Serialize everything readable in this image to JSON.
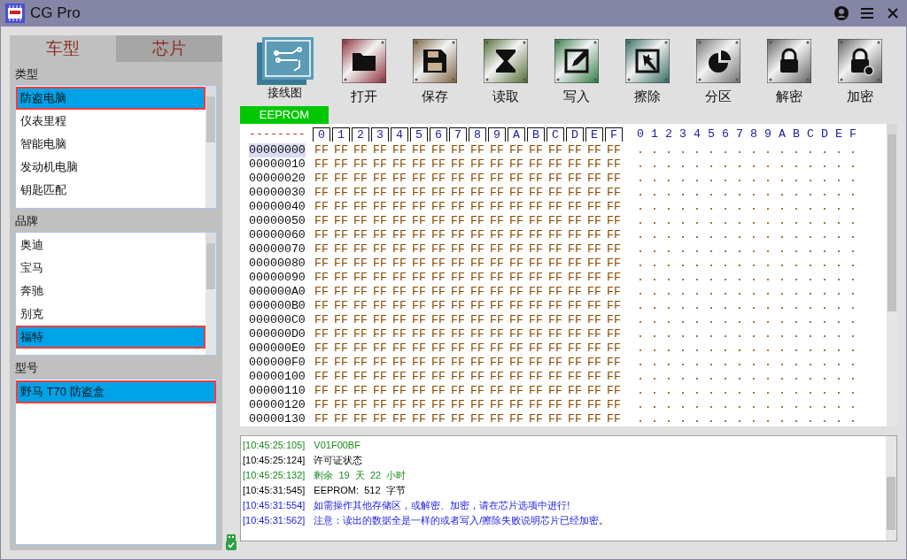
{
  "window": {
    "title": "CG Pro"
  },
  "tabs": [
    {
      "label": "车型",
      "selected": true
    },
    {
      "label": "芯片",
      "selected": false
    }
  ],
  "sections": [
    {
      "label": "类型",
      "items": [
        {
          "label": "防盗电脑",
          "selected": true
        },
        {
          "label": "仪表里程",
          "selected": false
        },
        {
          "label": "智能电脑",
          "selected": false
        },
        {
          "label": "发动机电脑",
          "selected": false
        },
        {
          "label": "钥匙匹配",
          "selected": false
        }
      ]
    },
    {
      "label": "品牌",
      "items": [
        {
          "label": "奥迪",
          "selected": false
        },
        {
          "label": "宝马",
          "selected": false
        },
        {
          "label": "奔驰",
          "selected": false
        },
        {
          "label": "别克",
          "selected": false
        },
        {
          "label": "福特",
          "selected": true
        }
      ]
    },
    {
      "label": "型号",
      "items": [
        {
          "label": "野马 T70 防盗盒",
          "selected": true
        }
      ]
    }
  ],
  "toolbar": [
    {
      "kind": "diagram",
      "label": "接线图"
    },
    {
      "kind": "open",
      "label": "打开"
    },
    {
      "kind": "save",
      "label": "保存"
    },
    {
      "kind": "read",
      "label": "读取"
    },
    {
      "kind": "write",
      "label": "写入"
    },
    {
      "kind": "erase",
      "label": "擦除"
    },
    {
      "kind": "partition",
      "label": "分区"
    },
    {
      "kind": "unlock",
      "label": "解密"
    },
    {
      "kind": "lock",
      "label": "加密"
    }
  ],
  "memory_tab": "EEPROM",
  "hex": {
    "corner": "--------",
    "columns": [
      "0",
      "1",
      "2",
      "3",
      "4",
      "5",
      "6",
      "7",
      "8",
      "9",
      "A",
      "B",
      "C",
      "D",
      "E",
      "F"
    ],
    "ascii_columns": [
      "0",
      "1",
      "2",
      "3",
      "4",
      "5",
      "6",
      "7",
      "8",
      "9",
      "A",
      "B",
      "C",
      "D",
      "E",
      "F"
    ],
    "rows": [
      {
        "address": "00000000",
        "selected": true,
        "bytes": [
          "FF",
          "FF",
          "FF",
          "FF",
          "FF",
          "FF",
          "FF",
          "FF",
          "FF",
          "FF",
          "FF",
          "FF",
          "FF",
          "FF",
          "FF",
          "FF"
        ],
        "ascii": [
          ".",
          ".",
          ".",
          ".",
          ".",
          ".",
          ".",
          ".",
          ".",
          ".",
          ".",
          ".",
          ".",
          ".",
          ".",
          "."
        ]
      },
      {
        "address": "00000010",
        "selected": false,
        "bytes": [
          "FF",
          "FF",
          "FF",
          "FF",
          "FF",
          "FF",
          "FF",
          "FF",
          "FF",
          "FF",
          "FF",
          "FF",
          "FF",
          "FF",
          "FF",
          "FF"
        ],
        "ascii": [
          ".",
          ".",
          ".",
          ".",
          ".",
          ".",
          ".",
          ".",
          ".",
          ".",
          ".",
          ".",
          ".",
          ".",
          ".",
          "."
        ]
      },
      {
        "address": "00000020",
        "selected": false,
        "bytes": [
          "FF",
          "FF",
          "FF",
          "FF",
          "FF",
          "FF",
          "FF",
          "FF",
          "FF",
          "FF",
          "FF",
          "FF",
          "FF",
          "FF",
          "FF",
          "FF"
        ],
        "ascii": [
          ".",
          ".",
          ".",
          ".",
          ".",
          ".",
          ".",
          ".",
          ".",
          ".",
          ".",
          ".",
          ".",
          ".",
          ".",
          "."
        ]
      },
      {
        "address": "00000030",
        "selected": false,
        "bytes": [
          "FF",
          "FF",
          "FF",
          "FF",
          "FF",
          "FF",
          "FF",
          "FF",
          "FF",
          "FF",
          "FF",
          "FF",
          "FF",
          "FF",
          "FF",
          "FF"
        ],
        "ascii": [
          ".",
          ".",
          ".",
          ".",
          ".",
          ".",
          ".",
          ".",
          ".",
          ".",
          ".",
          ".",
          ".",
          ".",
          ".",
          "."
        ]
      },
      {
        "address": "00000040",
        "selected": false,
        "bytes": [
          "FF",
          "FF",
          "FF",
          "FF",
          "FF",
          "FF",
          "FF",
          "FF",
          "FF",
          "FF",
          "FF",
          "FF",
          "FF",
          "FF",
          "FF",
          "FF"
        ],
        "ascii": [
          ".",
          ".",
          ".",
          ".",
          ".",
          ".",
          ".",
          ".",
          ".",
          ".",
          ".",
          ".",
          ".",
          ".",
          ".",
          "."
        ]
      },
      {
        "address": "00000050",
        "selected": false,
        "bytes": [
          "FF",
          "FF",
          "FF",
          "FF",
          "FF",
          "FF",
          "FF",
          "FF",
          "FF",
          "FF",
          "FF",
          "FF",
          "FF",
          "FF",
          "FF",
          "FF"
        ],
        "ascii": [
          ".",
          ".",
          ".",
          ".",
          ".",
          ".",
          ".",
          ".",
          ".",
          ".",
          ".",
          ".",
          ".",
          ".",
          ".",
          "."
        ]
      },
      {
        "address": "00000060",
        "selected": false,
        "bytes": [
          "FF",
          "FF",
          "FF",
          "FF",
          "FF",
          "FF",
          "FF",
          "FF",
          "FF",
          "FF",
          "FF",
          "FF",
          "FF",
          "FF",
          "FF",
          "FF"
        ],
        "ascii": [
          ".",
          ".",
          ".",
          ".",
          ".",
          ".",
          ".",
          ".",
          ".",
          ".",
          ".",
          ".",
          ".",
          ".",
          ".",
          "."
        ]
      },
      {
        "address": "00000070",
        "selected": false,
        "bytes": [
          "FF",
          "FF",
          "FF",
          "FF",
          "FF",
          "FF",
          "FF",
          "FF",
          "FF",
          "FF",
          "FF",
          "FF",
          "FF",
          "FF",
          "FF",
          "FF"
        ],
        "ascii": [
          ".",
          ".",
          ".",
          ".",
          ".",
          ".",
          ".",
          ".",
          ".",
          ".",
          ".",
          ".",
          ".",
          ".",
          ".",
          "."
        ]
      },
      {
        "address": "00000080",
        "selected": false,
        "bytes": [
          "FF",
          "FF",
          "FF",
          "FF",
          "FF",
          "FF",
          "FF",
          "FF",
          "FF",
          "FF",
          "FF",
          "FF",
          "FF",
          "FF",
          "FF",
          "FF"
        ],
        "ascii": [
          ".",
          ".",
          ".",
          ".",
          ".",
          ".",
          ".",
          ".",
          ".",
          ".",
          ".",
          ".",
          ".",
          ".",
          ".",
          "."
        ]
      },
      {
        "address": "00000090",
        "selected": false,
        "bytes": [
          "FF",
          "FF",
          "FF",
          "FF",
          "FF",
          "FF",
          "FF",
          "FF",
          "FF",
          "FF",
          "FF",
          "FF",
          "FF",
          "FF",
          "FF",
          "FF"
        ],
        "ascii": [
          ".",
          ".",
          ".",
          ".",
          ".",
          ".",
          ".",
          ".",
          ".",
          ".",
          ".",
          ".",
          ".",
          ".",
          ".",
          "."
        ]
      },
      {
        "address": "000000A0",
        "selected": false,
        "bytes": [
          "FF",
          "FF",
          "FF",
          "FF",
          "FF",
          "FF",
          "FF",
          "FF",
          "FF",
          "FF",
          "FF",
          "FF",
          "FF",
          "FF",
          "FF",
          "FF"
        ],
        "ascii": [
          ".",
          ".",
          ".",
          ".",
          ".",
          ".",
          ".",
          ".",
          ".",
          ".",
          ".",
          ".",
          ".",
          ".",
          ".",
          "."
        ]
      },
      {
        "address": "000000B0",
        "selected": false,
        "bytes": [
          "FF",
          "FF",
          "FF",
          "FF",
          "FF",
          "FF",
          "FF",
          "FF",
          "FF",
          "FF",
          "FF",
          "FF",
          "FF",
          "FF",
          "FF",
          "FF"
        ],
        "ascii": [
          ".",
          ".",
          ".",
          ".",
          ".",
          ".",
          ".",
          ".",
          ".",
          ".",
          ".",
          ".",
          ".",
          ".",
          ".",
          "."
        ]
      },
      {
        "address": "000000C0",
        "selected": false,
        "bytes": [
          "FF",
          "FF",
          "FF",
          "FF",
          "FF",
          "FF",
          "FF",
          "FF",
          "FF",
          "FF",
          "FF",
          "FF",
          "FF",
          "FF",
          "FF",
          "FF"
        ],
        "ascii": [
          ".",
          ".",
          ".",
          ".",
          ".",
          ".",
          ".",
          ".",
          ".",
          ".",
          ".",
          ".",
          ".",
          ".",
          ".",
          "."
        ]
      },
      {
        "address": "000000D0",
        "selected": false,
        "bytes": [
          "FF",
          "FF",
          "FF",
          "FF",
          "FF",
          "FF",
          "FF",
          "FF",
          "FF",
          "FF",
          "FF",
          "FF",
          "FF",
          "FF",
          "FF",
          "FF"
        ],
        "ascii": [
          ".",
          ".",
          ".",
          ".",
          ".",
          ".",
          ".",
          ".",
          ".",
          ".",
          ".",
          ".",
          ".",
          ".",
          ".",
          "."
        ]
      },
      {
        "address": "000000E0",
        "selected": false,
        "bytes": [
          "FF",
          "FF",
          "FF",
          "FF",
          "FF",
          "FF",
          "FF",
          "FF",
          "FF",
          "FF",
          "FF",
          "FF",
          "FF",
          "FF",
          "FF",
          "FF"
        ],
        "ascii": [
          ".",
          ".",
          ".",
          ".",
          ".",
          ".",
          ".",
          ".",
          ".",
          ".",
          ".",
          ".",
          ".",
          ".",
          ".",
          "."
        ]
      },
      {
        "address": "000000F0",
        "selected": false,
        "bytes": [
          "FF",
          "FF",
          "FF",
          "FF",
          "FF",
          "FF",
          "FF",
          "FF",
          "FF",
          "FF",
          "FF",
          "FF",
          "FF",
          "FF",
          "FF",
          "FF"
        ],
        "ascii": [
          ".",
          ".",
          ".",
          ".",
          ".",
          ".",
          ".",
          ".",
          ".",
          ".",
          ".",
          ".",
          ".",
          ".",
          ".",
          "."
        ]
      },
      {
        "address": "00000100",
        "selected": false,
        "bytes": [
          "FF",
          "FF",
          "FF",
          "FF",
          "FF",
          "FF",
          "FF",
          "FF",
          "FF",
          "FF",
          "FF",
          "FF",
          "FF",
          "FF",
          "FF",
          "FF"
        ],
        "ascii": [
          ".",
          ".",
          ".",
          ".",
          ".",
          ".",
          ".",
          ".",
          ".",
          ".",
          ".",
          ".",
          ".",
          ".",
          ".",
          "."
        ]
      },
      {
        "address": "00000110",
        "selected": false,
        "bytes": [
          "FF",
          "FF",
          "FF",
          "FF",
          "FF",
          "FF",
          "FF",
          "FF",
          "FF",
          "FF",
          "FF",
          "FF",
          "FF",
          "FF",
          "FF",
          "FF"
        ],
        "ascii": [
          ".",
          ".",
          ".",
          ".",
          ".",
          ".",
          ".",
          ".",
          ".",
          ".",
          ".",
          ".",
          ".",
          ".",
          ".",
          "."
        ]
      },
      {
        "address": "00000120",
        "selected": false,
        "bytes": [
          "FF",
          "FF",
          "FF",
          "FF",
          "FF",
          "FF",
          "FF",
          "FF",
          "FF",
          "FF",
          "FF",
          "FF",
          "FF",
          "FF",
          "FF",
          "FF"
        ],
        "ascii": [
          ".",
          ".",
          ".",
          ".",
          ".",
          ".",
          ".",
          ".",
          ".",
          ".",
          ".",
          ".",
          ".",
          ".",
          ".",
          "."
        ]
      },
      {
        "address": "00000130",
        "selected": false,
        "bytes": [
          "FF",
          "FF",
          "FF",
          "FF",
          "FF",
          "FF",
          "FF",
          "FF",
          "FF",
          "FF",
          "FF",
          "FF",
          "FF",
          "FF",
          "FF",
          "FF"
        ],
        "ascii": [
          ".",
          ".",
          ".",
          ".",
          ".",
          ".",
          ".",
          ".",
          ".",
          ".",
          ".",
          ".",
          ".",
          ".",
          ".",
          "."
        ]
      }
    ]
  },
  "log": [
    {
      "time": "[10:45:25:105]",
      "message": "V01F00BF",
      "color": "#1a8a1a"
    },
    {
      "time": "[10:45:25:124]",
      "message": "许可证状态",
      "color": "#000000"
    },
    {
      "time": "[10:45:25:132]",
      "message": "剩余  19  天  22  小时",
      "color": "#1a8a1a"
    },
    {
      "time": "[10:45:31:545]",
      "message": "EEPROM:  512  字节",
      "color": "#000000"
    },
    {
      "time": "[10:45:31:554]",
      "message": "如需操作其他存储区，或解密、加密，请在芯片选项中进行!",
      "color": "#1a1ae6"
    },
    {
      "time": "[10:45:31:562]",
      "message": "注意：读出的数据全是一样的或者写入/擦除失败说明芯片已经加密。",
      "color": "#1a1ae6"
    }
  ]
}
